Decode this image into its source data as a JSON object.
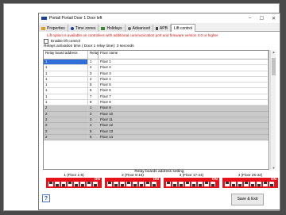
{
  "window": {
    "title": "Portail Portail Door 1 Door left"
  },
  "titlebar_buttons": {
    "minimize": "–",
    "maximize": "☐",
    "close": "✕"
  },
  "tabs": [
    {
      "label": "Properties",
      "icon": "folder-icon",
      "color": "#d8a020"
    },
    {
      "label": "Time zones",
      "icon": "clock-icon",
      "color": "#1a3f9a"
    },
    {
      "label": "Holidays",
      "icon": "calendar-icon",
      "color": "#3a8a3a"
    },
    {
      "label": "Advanced",
      "icon": "gear-icon",
      "color": "#666666"
    },
    {
      "label": "APB",
      "icon": "apb-icon",
      "color": "#444444"
    },
    {
      "label": "Lift control",
      "icon": "",
      "color": ""
    }
  ],
  "lift": {
    "warning": "Lift option is available on controllers with additional communication port and firmware version 4.0 or higher",
    "enable_label": "Enable lift control",
    "activation": "Relays activation time ( Door 1 relay time): 3 seconds"
  },
  "grid": {
    "headers": [
      "Relay board address",
      "Relay",
      "Floor name"
    ],
    "rows": [
      [
        "1",
        "1",
        "Floor 1"
      ],
      [
        "1",
        "2",
        "Floor 2"
      ],
      [
        "1",
        "3",
        "Floor 3"
      ],
      [
        "1",
        "4",
        "Floor 4"
      ],
      [
        "1",
        "5",
        "Floor 5"
      ],
      [
        "1",
        "6",
        "Floor 6"
      ],
      [
        "1",
        "7",
        "Floor 7"
      ],
      [
        "1",
        "8",
        "Floor 8"
      ],
      [
        "2",
        "1",
        "Floor 9"
      ],
      [
        "2",
        "2",
        "Floor 10"
      ],
      [
        "2",
        "3",
        "Floor 11"
      ],
      [
        "2",
        "4",
        "Floor 12"
      ],
      [
        "2",
        "5",
        "Floor 13"
      ],
      [
        "2",
        "6",
        "Floor 14"
      ]
    ]
  },
  "relay": {
    "title": "Relay boards address setting",
    "boards": [
      {
        "label": "1 (Floor 1-8)",
        "on": "ON"
      },
      {
        "label": "2 (Floor 9-16)",
        "on": "ON"
      },
      {
        "label": "3 (Floor 17-24)",
        "on": "ON"
      },
      {
        "label": "4 (Floor 25-32)",
        "on": "ON"
      }
    ]
  },
  "help_label": "?",
  "save_label": "Save & Exit",
  "colors": {
    "selection": "#2f6ed8",
    "dip": "#e8121a",
    "warning": "#d01010"
  }
}
